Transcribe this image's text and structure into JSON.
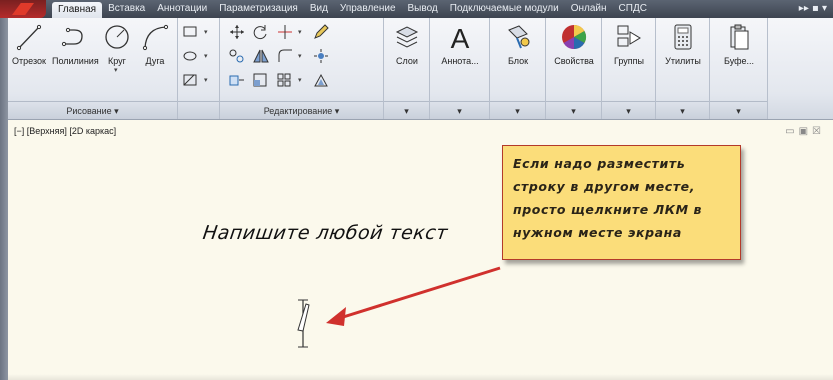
{
  "tabs": [
    {
      "label": "Главная",
      "active": true
    },
    {
      "label": "Вставка"
    },
    {
      "label": "Аннотации"
    },
    {
      "label": "Параметризация"
    },
    {
      "label": "Вид"
    },
    {
      "label": "Управление"
    },
    {
      "label": "Вывод"
    },
    {
      "label": "Подключаемые модули"
    },
    {
      "label": "Онлайн"
    },
    {
      "label": "СПДС"
    }
  ],
  "tab_extra": "▸▸ ▪ ▾",
  "ribbon": {
    "draw_panel": {
      "title": "Рисование ▾",
      "tools": {
        "line": "Отрезок",
        "polyline": "Полилиния",
        "circle": "Круг",
        "arc": "Дуга"
      }
    },
    "modify_panel": {
      "title": "Редактирование ▾"
    },
    "layers": {
      "label": "Слои"
    },
    "annotation": {
      "label": "Аннота..."
    },
    "block": {
      "label": "Блок"
    },
    "properties": {
      "label": "Свойства"
    },
    "groups": {
      "label": "Группы"
    },
    "utilities": {
      "label": "Утилиты"
    },
    "clipboard": {
      "label": "Буфе..."
    },
    "expander": "▾"
  },
  "viewport": {
    "label": "[−] [Верхняя] [2D каркас]",
    "controls": [
      "▭",
      "▣",
      "☒"
    ]
  },
  "canvas_text": "Напишите любой текст",
  "callout": {
    "lines": [
      "Если надо разместить",
      "строку в другом месте,",
      "просто щелкните ЛКМ в",
      "нужном месте экрана"
    ]
  },
  "colors": {
    "accent": "#d0312d",
    "callout_bg": "#fbdd7a",
    "canvas_bg": "#fbf9ec"
  },
  "icons": [
    "line-icon",
    "polyline-icon",
    "circle-icon",
    "arc-icon",
    "layers-icon",
    "text-annotation-icon",
    "block-icon",
    "color-wheel-icon",
    "group-icon",
    "calculator-icon",
    "clipboard-icon"
  ]
}
